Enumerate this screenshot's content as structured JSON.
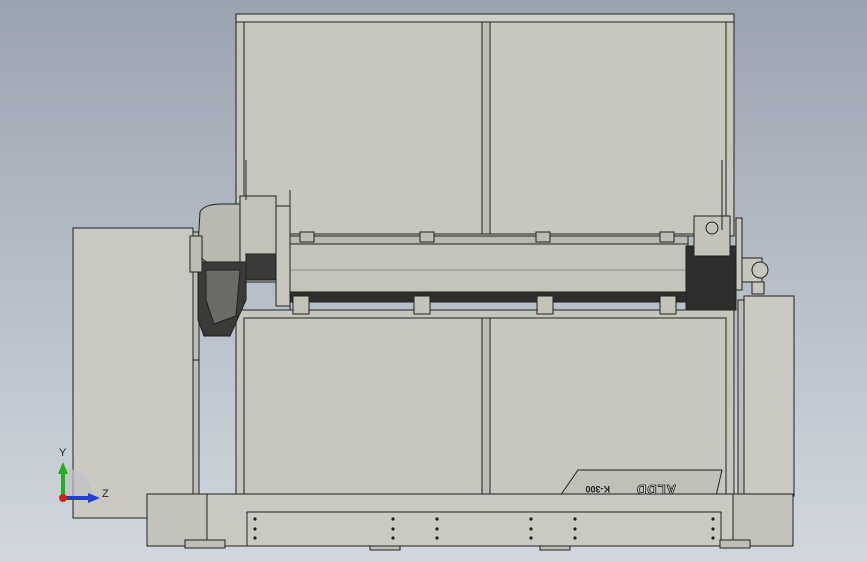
{
  "viewport": {
    "background_top": "#9aa3b0",
    "background_bottom": "#d2d7de",
    "part_fill": "#c8c8c0",
    "part_edge": "#202020",
    "dark_part_fill": "#3a3a38"
  },
  "triad": {
    "y_label": "Y",
    "z_label": "Z",
    "y_color": "#1db31d",
    "z_color": "#1f3fd6",
    "x_color": "#d62020"
  },
  "machine": {
    "nameplate": "K-300",
    "logo": "ALDD"
  }
}
